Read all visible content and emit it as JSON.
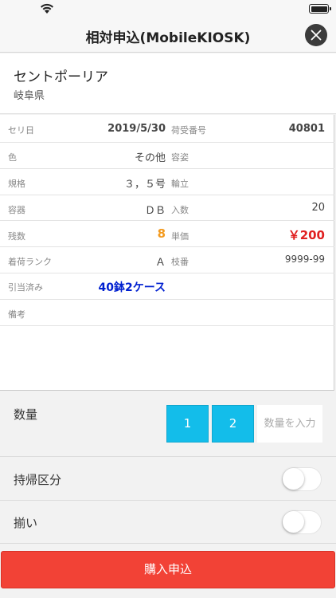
{
  "status_bar": {
    "wifi_icon": "wifi-icon",
    "battery_icon": "battery-icon"
  },
  "nav": {
    "title": "相対申込(MobileKIOSK)",
    "close_icon": "close-icon"
  },
  "product": {
    "name": "セントポーリア",
    "prefecture": "岐阜県"
  },
  "details": {
    "auction_date_label": "セリ日",
    "auction_date": "2019/5/30",
    "receipt_no_label": "荷受番号",
    "receipt_no": "40801",
    "color_label": "色",
    "color": "その他",
    "shape_label": "容姿",
    "shape": "",
    "spec_label": "規格",
    "spec": "３，５号",
    "flower_count_label": "輪立",
    "flower_count": "",
    "container_label": "容器",
    "container": "ＤＢ",
    "qty_per_label": "入数",
    "qty_per": "20",
    "remaining_label": "残数",
    "remaining": "8",
    "unit_price_label": "単価",
    "unit_price": "￥200",
    "rank_label": "着荷ランク",
    "rank": "Ａ",
    "branch_no_label": "枝番",
    "branch_no": "9999-99",
    "allocated_label": "引当済み",
    "allocated": "40鉢2ケース",
    "remarks_label": "備考",
    "remarks": ""
  },
  "quantity": {
    "label": "数量",
    "button_1": "1",
    "button_2": "2",
    "input_placeholder": "数量を入力"
  },
  "takeout": {
    "label": "持帰区分",
    "on": false
  },
  "matching": {
    "label": "揃い",
    "on": false
  },
  "submit_label": "購入申込",
  "colors": {
    "accent_blue": "#13bdea",
    "submit_red": "#f24236",
    "price_red": "#e02020",
    "remaining_orange": "#f39a1e",
    "allocated_blue": "#0020d0"
  }
}
